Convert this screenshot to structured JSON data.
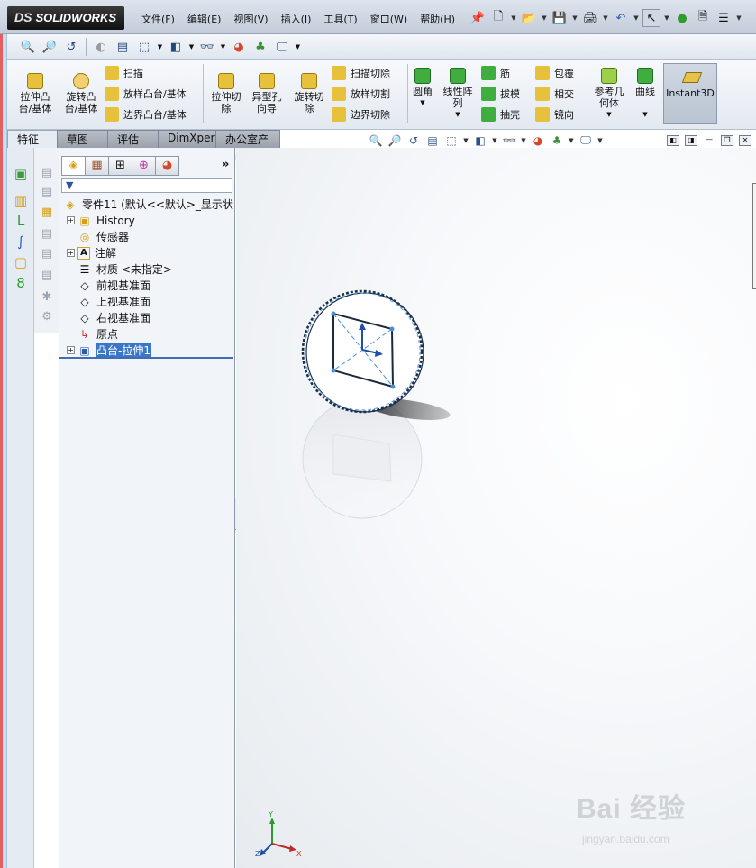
{
  "app": {
    "logo_text": "SOLIDWORKS",
    "logo_mark": "DS"
  },
  "menu": [
    "文件(F)",
    "编辑(E)",
    "视图(V)",
    "插入(I)",
    "工具(T)",
    "窗口(W)",
    "帮助(H)"
  ],
  "command_manager": {
    "extrude_boss": "拉伸凸\n台/基体",
    "revolve_boss": "旋转凸\n台/基体",
    "sweep": "扫描",
    "loft_boss": "放样凸台/基体",
    "boundary_boss": "边界凸台/基体",
    "extrude_cut": "拉伸切\n除",
    "hole_wizard": "异型孔\n向导",
    "revolve_cut": "旋转切\n除",
    "sweep_cut": "扫描切除",
    "loft_cut": "放样切割",
    "boundary_cut": "边界切除",
    "fillet": "圆角",
    "linear_pattern": "线性阵\n列",
    "rib": "筋",
    "draft": "拔模",
    "shell": "抽壳",
    "wrap": "包覆",
    "intersect": "相交",
    "mirror": "镜向",
    "ref_geometry": "参考几\n何体",
    "curves": "曲线",
    "instant3d": "Instant3D"
  },
  "tabs": [
    "特征",
    "草图",
    "评估",
    "DimXpert",
    "办公室产品"
  ],
  "active_tab": "特征",
  "tree": {
    "part_name": "零件11 (默认<<默认>_显示状",
    "nodes": [
      {
        "label": "History",
        "icon": "history-folder-icon",
        "expandable": true
      },
      {
        "label": "传感器",
        "icon": "sensor-icon",
        "expandable": false
      },
      {
        "label": "注解",
        "icon": "annotation-icon",
        "expandable": true
      },
      {
        "label": "材质 <未指定>",
        "icon": "material-icon",
        "expandable": false
      },
      {
        "label": "前视基准面",
        "icon": "plane-icon",
        "expandable": false
      },
      {
        "label": "上视基准面",
        "icon": "plane-icon",
        "expandable": false
      },
      {
        "label": "右视基准面",
        "icon": "plane-icon",
        "expandable": false
      },
      {
        "label": "原点",
        "icon": "origin-icon",
        "expandable": false
      },
      {
        "label": "凸台-拉伸1",
        "icon": "extrude-feature-icon",
        "expandable": true,
        "selected": true
      }
    ]
  },
  "axes": {
    "x": "X",
    "y": "Y",
    "z": "Z"
  },
  "watermark": {
    "big": "Bai 经验",
    "small": "jingyan.baidu.com"
  },
  "colors": {
    "selection": "#3a77c9",
    "sketch_blue": "#2a6fc4",
    "titlebar": "#c9d2de"
  }
}
